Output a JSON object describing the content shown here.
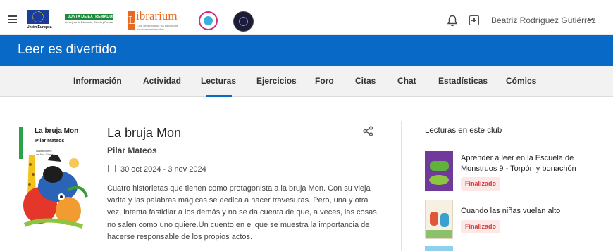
{
  "header": {
    "logos": {
      "eu_label": "Unión Europea",
      "junta_label": "JUNTA DE EXTREMADURA",
      "junta_sub": "Consejería de Educación, Ciencia y Formación Profesional",
      "librarium_letter": "L",
      "librarium_word": "ibrarium",
      "librarium_sub": "Club de lectura de las bibliotecas escolares extremeñas"
    },
    "icons": [
      "hamburger-icon",
      "bell-icon",
      "add-box-icon",
      "chevron-down-icon"
    ],
    "user_name": "Beatriz Rodríguez Gutiérrez"
  },
  "banner": {
    "title": "Leer es divertido",
    "color": "#0969c6"
  },
  "tabs": [
    {
      "label": "Información"
    },
    {
      "label": "Actividad"
    },
    {
      "label": "Lecturas",
      "active": true
    },
    {
      "label": "Ejercicios"
    },
    {
      "label": "Foro"
    },
    {
      "label": "Citas"
    },
    {
      "label": "Chat"
    },
    {
      "label": "Estadísticas"
    },
    {
      "label": "Cómics"
    }
  ],
  "book": {
    "cover": {
      "title": "La bruja Mon",
      "author": "Pilar Mateos",
      "illustrator_line1": "Ilustraciones",
      "illustrator_line2": "de Ana Gómez"
    },
    "title": "La bruja Mon",
    "author": "Pilar Mateos",
    "dates": "30 oct 2024 - 3 nov 2024",
    "description": "Cuatro historietas que tienen como protagonista a la bruja Mon. Con su vieja varita y las palabras mágicas se dedica a hacer travesuras. Pero, una y otra vez, intenta fastidiar a los demás y no se da cuenta de que, a veces, las cosas no salen como uno quiere.Un cuento en el que se muestra la importancia de hacerse responsable de los propios actos."
  },
  "sidebar": {
    "title": "Lecturas en este club",
    "books": [
      {
        "title": "Aprender a leer en la Escuela de Monstruos 9 - Torpón y bonachón",
        "status": "Finalizado"
      },
      {
        "title": "Cuando las niñas vuelan alto",
        "status": "Finalizado"
      }
    ]
  }
}
